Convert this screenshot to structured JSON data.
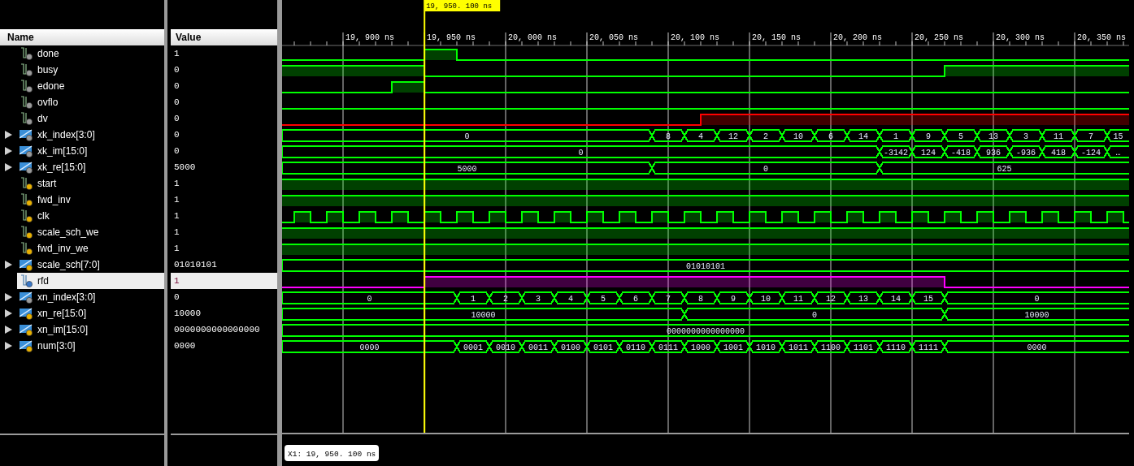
{
  "columns": {
    "name": "Name",
    "value": "Value"
  },
  "cursor": {
    "label": "19, 950. 100 ns"
  },
  "ticks": [
    "19, 900 ns",
    "19, 950 ns",
    "20, 000 ns",
    "20, 050 ns",
    "20, 100 ns",
    "20, 150 ns",
    "20, 200 ns",
    "20, 250 ns",
    "20, 300 ns",
    "20, 350 ns"
  ],
  "signals": [
    {
      "name": "done",
      "value": "1",
      "kind": "bit",
      "input": false,
      "expandable": false,
      "selected": false,
      "color": "#00ff00"
    },
    {
      "name": "busy",
      "value": "0",
      "kind": "bit",
      "input": false,
      "expandable": false,
      "selected": false,
      "color": "#00ff00"
    },
    {
      "name": "edone",
      "value": "0",
      "kind": "bit",
      "input": false,
      "expandable": false,
      "selected": false,
      "color": "#00ff00"
    },
    {
      "name": "ovflo",
      "value": "0",
      "kind": "bit",
      "input": false,
      "expandable": false,
      "selected": false,
      "color": "#00ff00"
    },
    {
      "name": "dv",
      "value": "0",
      "kind": "bit",
      "input": false,
      "expandable": false,
      "selected": false,
      "color": "#ff0000"
    },
    {
      "name": "xk_index[3:0]",
      "value": "0",
      "kind": "bus",
      "input": false,
      "expandable": true,
      "selected": false,
      "color": "#00ff00",
      "segments": [
        "0",
        "8",
        "4",
        "12",
        "2",
        "10",
        "6",
        "14",
        "1",
        "9",
        "5",
        "13",
        "3",
        "11",
        "7",
        "15"
      ]
    },
    {
      "name": "xk_im[15:0]",
      "value": "0",
      "kind": "bus",
      "input": false,
      "expandable": true,
      "selected": false,
      "color": "#00ff00",
      "segments": [
        "0",
        "-3142",
        "124",
        "-418",
        "936",
        "-936",
        "418",
        "-124",
        "…"
      ]
    },
    {
      "name": "xk_re[15:0]",
      "value": "5000",
      "kind": "bus",
      "input": false,
      "expandable": true,
      "selected": false,
      "color": "#00ff00",
      "segments": [
        "5000",
        "0",
        "625"
      ]
    },
    {
      "name": "start",
      "value": "1",
      "kind": "bit",
      "input": true,
      "expandable": false,
      "selected": false,
      "color": "#00ff00"
    },
    {
      "name": "fwd_inv",
      "value": "1",
      "kind": "bit",
      "input": true,
      "expandable": false,
      "selected": false,
      "color": "#00ff00"
    },
    {
      "name": "clk",
      "value": "1",
      "kind": "clock",
      "input": true,
      "expandable": false,
      "selected": false,
      "color": "#00ff00"
    },
    {
      "name": "scale_sch_we",
      "value": "1",
      "kind": "bit",
      "input": true,
      "expandable": false,
      "selected": false,
      "color": "#00ff00"
    },
    {
      "name": "fwd_inv_we",
      "value": "1",
      "kind": "bit",
      "input": true,
      "expandable": false,
      "selected": false,
      "color": "#00ff00"
    },
    {
      "name": "scale_sch[7:0]",
      "value": "01010101",
      "kind": "bus",
      "input": true,
      "expandable": true,
      "selected": false,
      "color": "#00ff00",
      "segments": [
        "01010101"
      ]
    },
    {
      "name": "rfd",
      "value": "1",
      "kind": "bit",
      "input": false,
      "expandable": false,
      "selected": true,
      "color": "#ff00ff"
    },
    {
      "name": "xn_index[3:0]",
      "value": "0",
      "kind": "bus",
      "input": false,
      "expandable": true,
      "selected": false,
      "color": "#00ff00",
      "segments": [
        "0",
        "1",
        "2",
        "3",
        "4",
        "5",
        "6",
        "7",
        "8",
        "9",
        "10",
        "11",
        "12",
        "13",
        "14",
        "15",
        "0"
      ]
    },
    {
      "name": "xn_re[15:0]",
      "value": "10000",
      "kind": "bus",
      "input": true,
      "expandable": true,
      "selected": false,
      "color": "#00ff00",
      "segments": [
        "10000",
        "0",
        "10000"
      ]
    },
    {
      "name": "xn_im[15:0]",
      "value": "0000000000000000",
      "kind": "bus",
      "input": true,
      "expandable": true,
      "selected": false,
      "color": "#00ff00",
      "segments": [
        "0000000000000000"
      ]
    },
    {
      "name": "num[3:0]",
      "value": "0000",
      "kind": "bus",
      "input": true,
      "expandable": true,
      "selected": false,
      "color": "#00ff00",
      "segments": [
        "0000",
        "0001",
        "0010",
        "0011",
        "0100",
        "0101",
        "0110",
        "0111",
        "1000",
        "1001",
        "1010",
        "1011",
        "1100",
        "1101",
        "1110",
        "1111",
        "0000"
      ]
    }
  ],
  "marker_readout": "X1: 19, 950. 100 ns"
}
